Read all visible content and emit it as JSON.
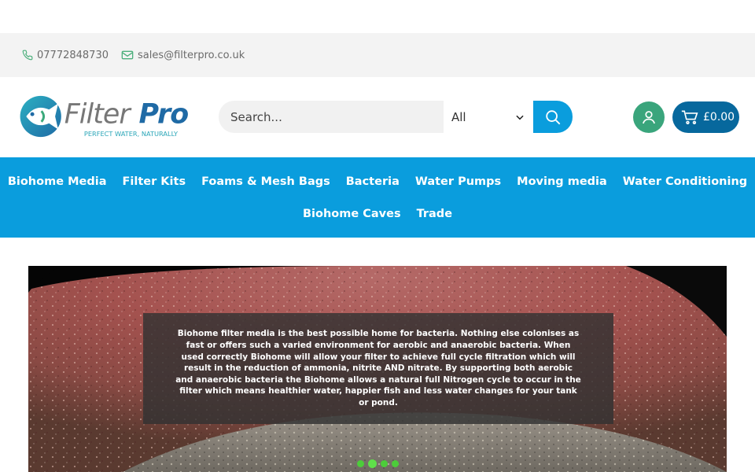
{
  "topbar": {
    "phone": "07772848730",
    "email": "sales@filterpro.co.uk"
  },
  "logo": {
    "brand": "FilterPro",
    "tagline": "PERFECT WATER, NATURALLY",
    "colors": {
      "teal": "#25a8b8",
      "blue": "#1f6aa5",
      "green": "#3ba97b"
    }
  },
  "search": {
    "placeholder": "Search...",
    "category_selected": "All"
  },
  "cart": {
    "total": "£0.00"
  },
  "nav": {
    "row1": [
      "Biohome Media",
      "Filter Kits",
      "Foams & Mesh Bags",
      "Bacteria",
      "Water Pumps",
      "Moving media",
      "Water Conditioning"
    ],
    "row2": [
      "Biohome Caves",
      "Trade"
    ]
  },
  "hero": {
    "text": "Biohome filter media is the best possible home for bacteria. Nothing else colonises as fast or offers such a varied environment for aerobic and anaerobic bacteria. When used correctly Biohome will allow your filter to achieve full cycle filtration which will result in the reduction of ammonia, nitrite AND nitrate. By supporting both aerobic and anaerobic bacteria the Biohome allows a natural full Nitrogen cycle to occur in the filter which means healthier water, happier fish and less water changes for your tank or pond.",
    "slides_count": 4,
    "active_slide": 2
  },
  "colors": {
    "nav_bg": "#0a9ddd",
    "account": "#3aa57c",
    "cart": "#07689d",
    "dot": "#4ccd3a"
  }
}
